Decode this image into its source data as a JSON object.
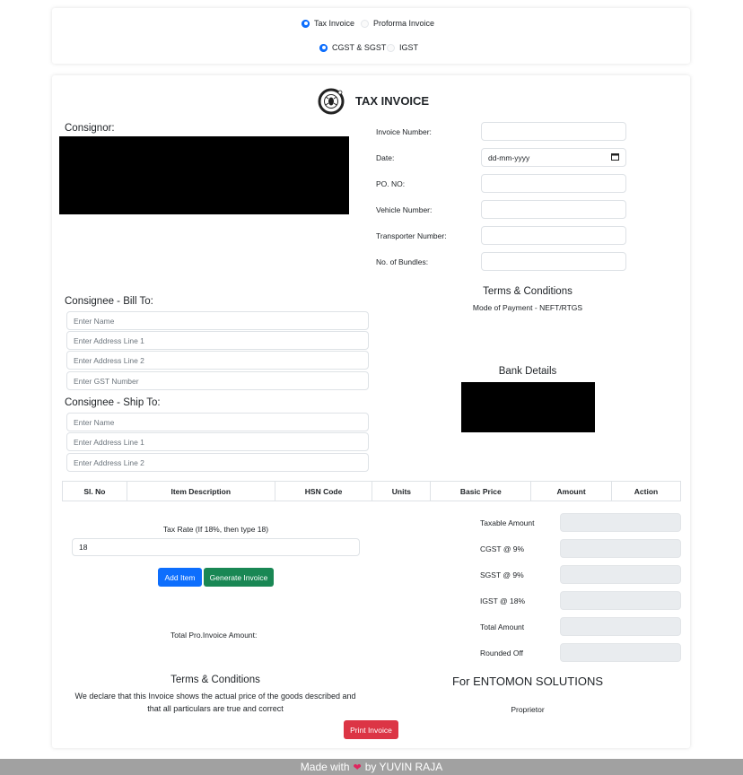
{
  "invoice_type": {
    "options": [
      {
        "label": "Tax Invoice",
        "selected": true
      },
      {
        "label": "Proforma Invoice",
        "selected": false
      }
    ]
  },
  "gst_type": {
    "options": [
      {
        "label": "CGST & SGST",
        "selected": true
      },
      {
        "label": "IGST",
        "selected": false
      }
    ]
  },
  "header": {
    "title": "TAX INVOICE",
    "logo_icon": "entomon-bug-logo-icon"
  },
  "consignor": {
    "label": "Consignor:"
  },
  "invoice_fields": [
    {
      "label": "Invoice Number:",
      "value": ""
    },
    {
      "label": "Date:",
      "value": "dd-mm-yyyy"
    },
    {
      "label": "PO. NO:",
      "value": ""
    },
    {
      "label": "Vehicle Number:",
      "value": ""
    },
    {
      "label": "Transporter Number:",
      "value": ""
    },
    {
      "label": "No. of Bundles:",
      "value": ""
    }
  ],
  "terms_top": {
    "title": "Terms & Conditions",
    "mode_of_payment": "Mode of Payment - NEFT/RTGS"
  },
  "bank": {
    "title": "Bank Details"
  },
  "bill_to": {
    "title": "Consignee - Bill To:",
    "name_placeholder": "Enter Name",
    "address1_placeholder": "Enter Address Line 1",
    "address2_placeholder": "Enter Address Line 2",
    "gst_placeholder": "Enter GST Number"
  },
  "ship_to": {
    "title": "Consignee - Ship To:",
    "name_placeholder": "Enter Name",
    "address1_placeholder": "Enter Address Line 1",
    "address2_placeholder": "Enter Address Line 2"
  },
  "items_table": {
    "columns": [
      "Sl. No",
      "Item Description",
      "HSN Code",
      "Units",
      "Basic Price",
      "Amount",
      "Action"
    ]
  },
  "tax": {
    "label": "Tax Rate (If 18%, then type 18)",
    "value": "18"
  },
  "buttons": {
    "add_item": "Add Item",
    "generate_invoice": "Generate Invoice",
    "print_invoice": "Print Invoice"
  },
  "colors": {
    "primary": "#0d6efd",
    "success": "#198754",
    "danger": "#dc3545",
    "footer_bg": "#a1a1a1",
    "heart": "#e0245e"
  },
  "totals": {
    "labels": [
      "Taxable Amount",
      "CGST @ 9%",
      "SGST @ 9%",
      "IGST @ 18%",
      "Total Amount",
      "Rounded Off"
    ]
  },
  "total_pro_invoice_label": "Total Pro.Invoice Amount:",
  "terms_bottom": {
    "title": "Terms & Conditions",
    "line1": "We declare that this Invoice shows the actual price of the goods described and",
    "line2": "that all particulars are true and correct"
  },
  "signature": {
    "company": "For ENTOMON SOLUTIONS",
    "role": "Proprietor"
  },
  "footer": {
    "prefix": "Made with",
    "heart_icon": "heart-icon",
    "suffix": "by YUVIN RAJA"
  }
}
